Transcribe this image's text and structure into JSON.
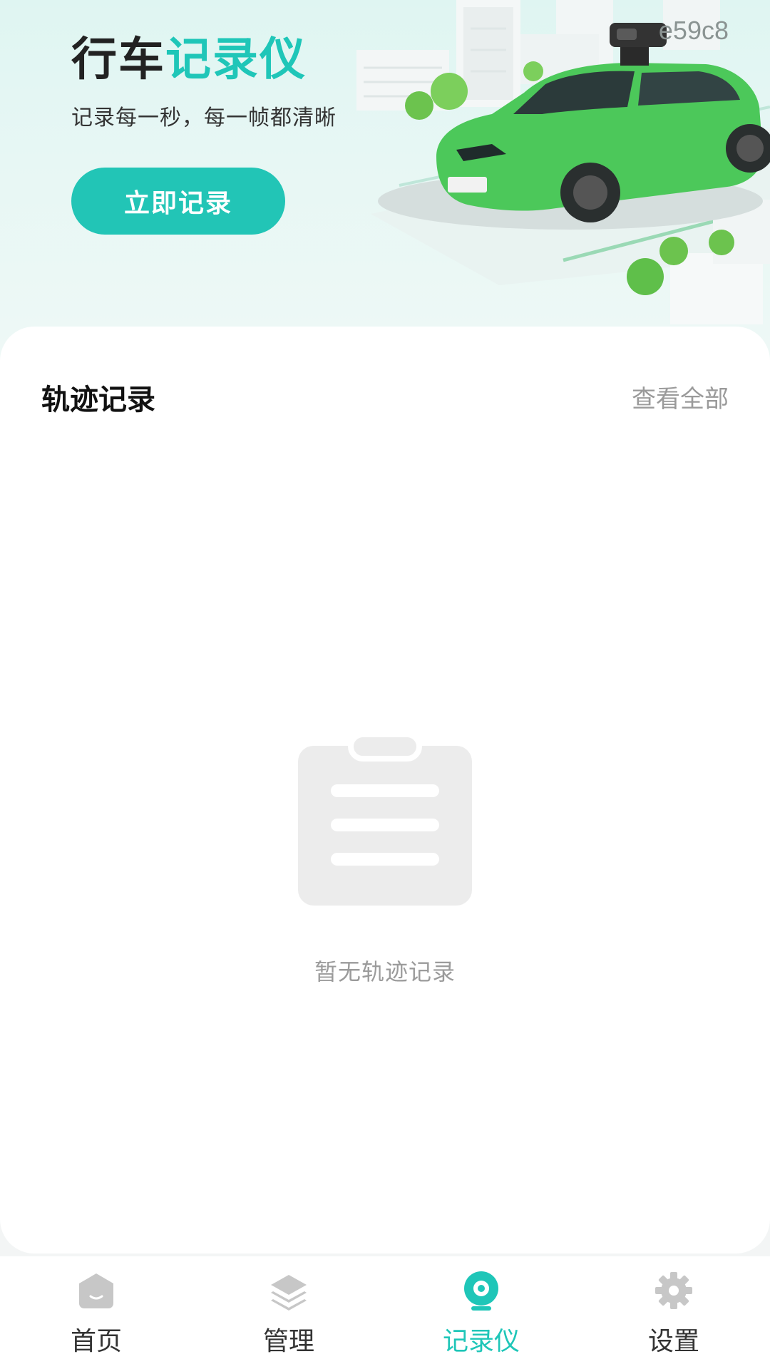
{
  "hero": {
    "device_id": "e59c8",
    "title_plain": "行车",
    "title_accent": "记录仪",
    "subtitle": "记录每一秒，每一帧都清晰",
    "record_button": "立即记录",
    "image": "green-car-with-dashcam-illustration"
  },
  "track_section": {
    "title": "轨迹记录",
    "view_all": "查看全部",
    "empty_text": "暂无轨迹记录",
    "empty_icon": "clipboard-icon"
  },
  "tabbar": {
    "items": [
      {
        "label": "首页",
        "icon": "home-icon",
        "active": false
      },
      {
        "label": "管理",
        "icon": "layers-icon",
        "active": false
      },
      {
        "label": "记录仪",
        "icon": "camera-icon",
        "active": true
      },
      {
        "label": "设置",
        "icon": "gear-icon",
        "active": false
      }
    ]
  },
  "colors": {
    "accent": "#1fc6b8",
    "button": "#22c5b6",
    "car": "#4cc85a",
    "inactive_icon": "#c7c7c7",
    "muted_text": "#9b9b9b"
  }
}
